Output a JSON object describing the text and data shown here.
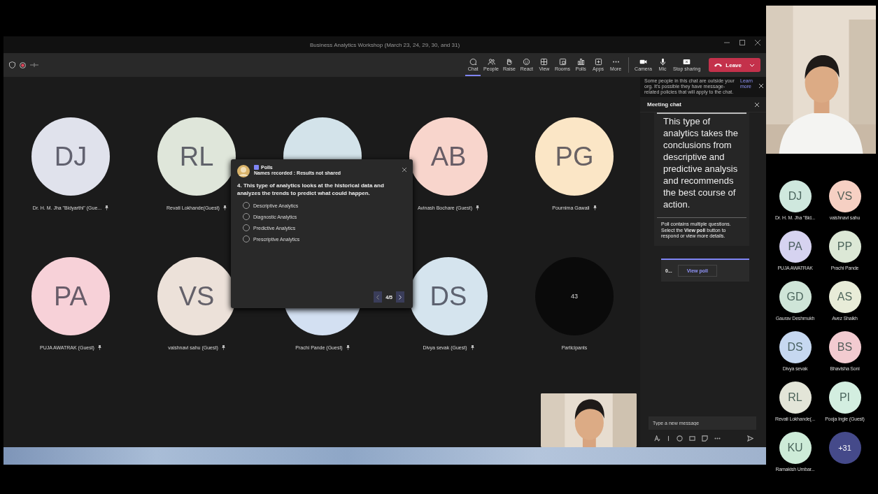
{
  "window": {
    "title": "Business Analytics Workshop (March 23, 24, 29, 30, and 31)"
  },
  "toolbar": {
    "buttons": [
      {
        "kind": "chat",
        "label": "Chat",
        "selected": true
      },
      {
        "kind": "people",
        "label": "People",
        "selected": false
      },
      {
        "kind": "raise",
        "label": "Raise",
        "selected": false
      },
      {
        "kind": "react",
        "label": "React",
        "selected": false
      },
      {
        "kind": "view",
        "label": "View",
        "selected": false
      },
      {
        "kind": "rooms",
        "label": "Rooms",
        "selected": false
      },
      {
        "kind": "polls",
        "label": "Polls",
        "selected": false
      },
      {
        "kind": "apps",
        "label": "Apps",
        "selected": false
      },
      {
        "kind": "more",
        "label": "More",
        "selected": false
      },
      {
        "kind": "camera",
        "label": "Camera",
        "selected": false
      },
      {
        "kind": "mic",
        "label": "Mic",
        "selected": false
      },
      {
        "kind": "share",
        "label": "Stop sharing",
        "selected": false
      }
    ],
    "leave": "Leave"
  },
  "stage": {
    "tiles": [
      {
        "kind": "person",
        "initials": "DJ",
        "name": "Dr. H. M. Jha \"Bidyarthi\" (Gue...",
        "color": "#e0e2ec"
      },
      {
        "kind": "person",
        "initials": "RL",
        "name": "Revati Lokhande(Guest)",
        "color": "#dfe6da"
      },
      {
        "kind": "person",
        "color": "#d3e3ea"
      },
      {
        "kind": "person",
        "initials": "AB",
        "name": "Avinash Bochare (Guest)",
        "color": "#f8d5cc"
      },
      {
        "kind": "person",
        "initials": "PG",
        "name": "Pournima Gawali",
        "color": "#fbe6c6"
      },
      {
        "kind": "person",
        "initials": "PA",
        "name": "PUJA AWATRAK (Guest)",
        "color": "#f7d1d8"
      },
      {
        "kind": "person",
        "initials": "VS",
        "name": "vaishnavi sahu (Guest)",
        "color": "#ece1d9"
      },
      {
        "kind": "person",
        "name": "Prachi Pande (Guest)",
        "color": "#d3e0f2"
      },
      {
        "kind": "person",
        "initials": "DS",
        "name": "Divya sevak (Guest)",
        "color": "#d5e4ee"
      },
      {
        "kind": "count",
        "initials": "43",
        "name": "Participants",
        "color": "#0a0a0a"
      }
    ]
  },
  "poll": {
    "app": "Polls",
    "status": "Names recorded : Results not shared",
    "question": "4. This type of analytics looks at the historical data and analyzes the trends to predict what could happen.",
    "options": [
      {
        "label": "Descriptive Analytics",
        "selected": false
      },
      {
        "label": "Diagnostic Analytics",
        "selected": false
      },
      {
        "label": "Predictive Analytics",
        "selected": false
      },
      {
        "label": "Prescriptive Analytics",
        "selected": false
      }
    ],
    "page": "4/5"
  },
  "chat": {
    "notice": "Some people in this chat are outside your org. It's possible they have message-related policies that will apply to the chat.",
    "notice_link": "Learn more",
    "title": "Meeting chat",
    "card_text": "This type of analytics takes the conclusions from descriptive and predictive analysis and recommends the best course of action.",
    "card_note": "Poll contains multiple questions. Select the **View poll** button to respond or view more details.",
    "poll_summary": "0...",
    "view_poll": "View poll",
    "compose_placeholder": "Type a new message"
  },
  "roster": [
    {
      "initials": "DJ",
      "name": "Dr. H. M. Jha \"Bid...",
      "color": "#cfe8de",
      "kind": "person"
    },
    {
      "initials": "VS",
      "name": "vaishnavi sahu",
      "color": "#f6d0c3",
      "kind": "person"
    },
    {
      "initials": "PA",
      "name": "PUJA AWATRAK",
      "color": "#d6d3f0",
      "kind": "person"
    },
    {
      "initials": "PP",
      "name": "Prachi Pande",
      "color": "#dce8d6",
      "kind": "person"
    },
    {
      "initials": "GD",
      "name": "Gaurav Deshmukh",
      "color": "#cfe5d8",
      "kind": "person"
    },
    {
      "initials": "AS",
      "name": "Avez Shaikh",
      "color": "#e8ecd8",
      "kind": "person"
    },
    {
      "initials": "DS",
      "name": "Divya sevak",
      "color": "#c6d8f0",
      "kind": "person"
    },
    {
      "initials": "BS",
      "name": "Bhavisha Soni",
      "color": "#f2cbd0",
      "kind": "person"
    },
    {
      "initials": "RL",
      "name": "Revati Lokhande(...",
      "color": "#e3e5d8",
      "kind": "person"
    },
    {
      "initials": "PI",
      "name": "Pooja Ingle (Guest)",
      "color": "#d3eee0",
      "kind": "person"
    },
    {
      "initials": "KU",
      "name": "Ramakish Umbar...",
      "color": "#cdebd8",
      "kind": "person"
    },
    {
      "initials": "+31",
      "color": "#454a8a",
      "kind": "overflow"
    }
  ]
}
